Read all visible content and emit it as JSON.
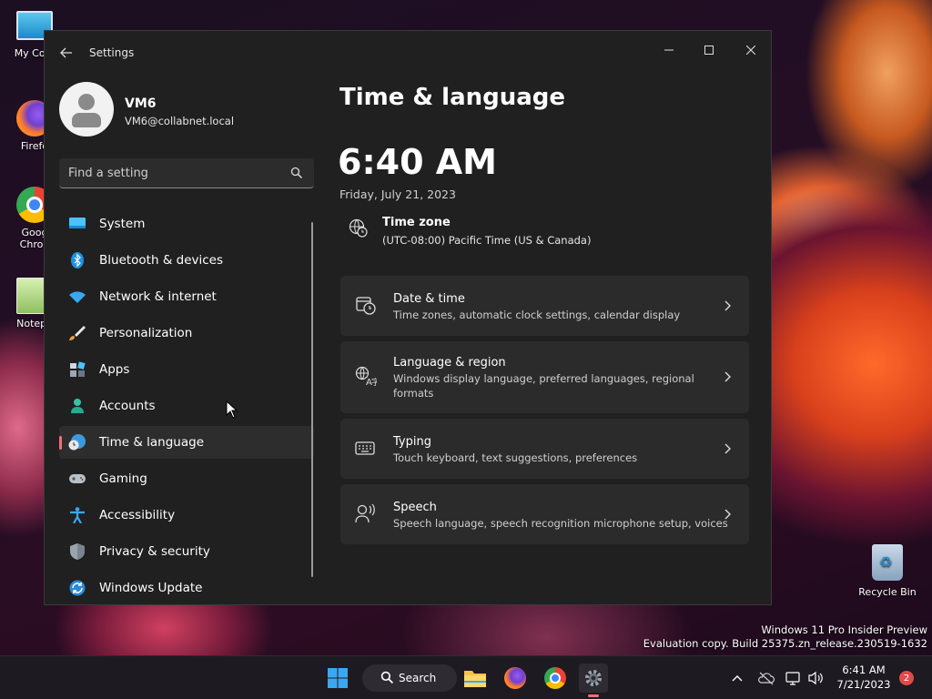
{
  "desktop": {
    "icons": [
      {
        "label": "My Com"
      },
      {
        "label": "Firefo"
      },
      {
        "label": "Goog"
      },
      {
        "label": "Chron"
      },
      {
        "label": "Notepa"
      }
    ],
    "recycle_bin": "Recycle Bin",
    "watermark_line1": "Windows 11 Pro Insider Preview",
    "watermark_line2": "Evaluation copy. Build 25375.zn_release.230519-1632"
  },
  "window": {
    "title": "Settings",
    "controls": {
      "minimize": "—",
      "maximize": "☐",
      "close": "✕"
    }
  },
  "profile": {
    "name": "VM6",
    "email": "VM6@collabnet.local"
  },
  "search": {
    "placeholder": "Find a setting"
  },
  "nav": {
    "items": [
      {
        "label": "System",
        "icon": "system-icon"
      },
      {
        "label": "Bluetooth & devices",
        "icon": "bluetooth-icon"
      },
      {
        "label": "Network & internet",
        "icon": "wifi-icon"
      },
      {
        "label": "Personalization",
        "icon": "brush-icon"
      },
      {
        "label": "Apps",
        "icon": "apps-icon"
      },
      {
        "label": "Accounts",
        "icon": "accounts-icon"
      },
      {
        "label": "Time & language",
        "icon": "time-language-icon",
        "active": true
      },
      {
        "label": "Gaming",
        "icon": "gamepad-icon"
      },
      {
        "label": "Accessibility",
        "icon": "accessibility-icon"
      },
      {
        "label": "Privacy & security",
        "icon": "shield-icon"
      },
      {
        "label": "Windows Update",
        "icon": "update-icon"
      }
    ]
  },
  "main": {
    "title": "Time & language",
    "clock": "6:40 AM",
    "date": "Friday, July 21, 2023",
    "timezone": {
      "title": "Time zone",
      "value": "(UTC-08:00) Pacific Time (US & Canada)"
    },
    "cards": [
      {
        "title": "Date & time",
        "desc": "Time zones, automatic clock settings, calendar display",
        "icon": "calendar-clock-icon"
      },
      {
        "title": "Language & region",
        "desc": "Windows display language, preferred languages, regional formats",
        "icon": "language-icon"
      },
      {
        "title": "Typing",
        "desc": "Touch keyboard, text suggestions, preferences",
        "icon": "keyboard-icon"
      },
      {
        "title": "Speech",
        "desc": "Speech language, speech recognition microphone setup, voices",
        "icon": "speech-icon"
      }
    ]
  },
  "taskbar": {
    "search_label": "Search",
    "time": "6:41 AM",
    "date": "7/21/2023",
    "notification_count": "2"
  },
  "colors": {
    "accent": "#f06e78",
    "window_bg": "#202020",
    "card_bg": "#2b2b2b",
    "taskbar_bg": "#1d1a22"
  }
}
